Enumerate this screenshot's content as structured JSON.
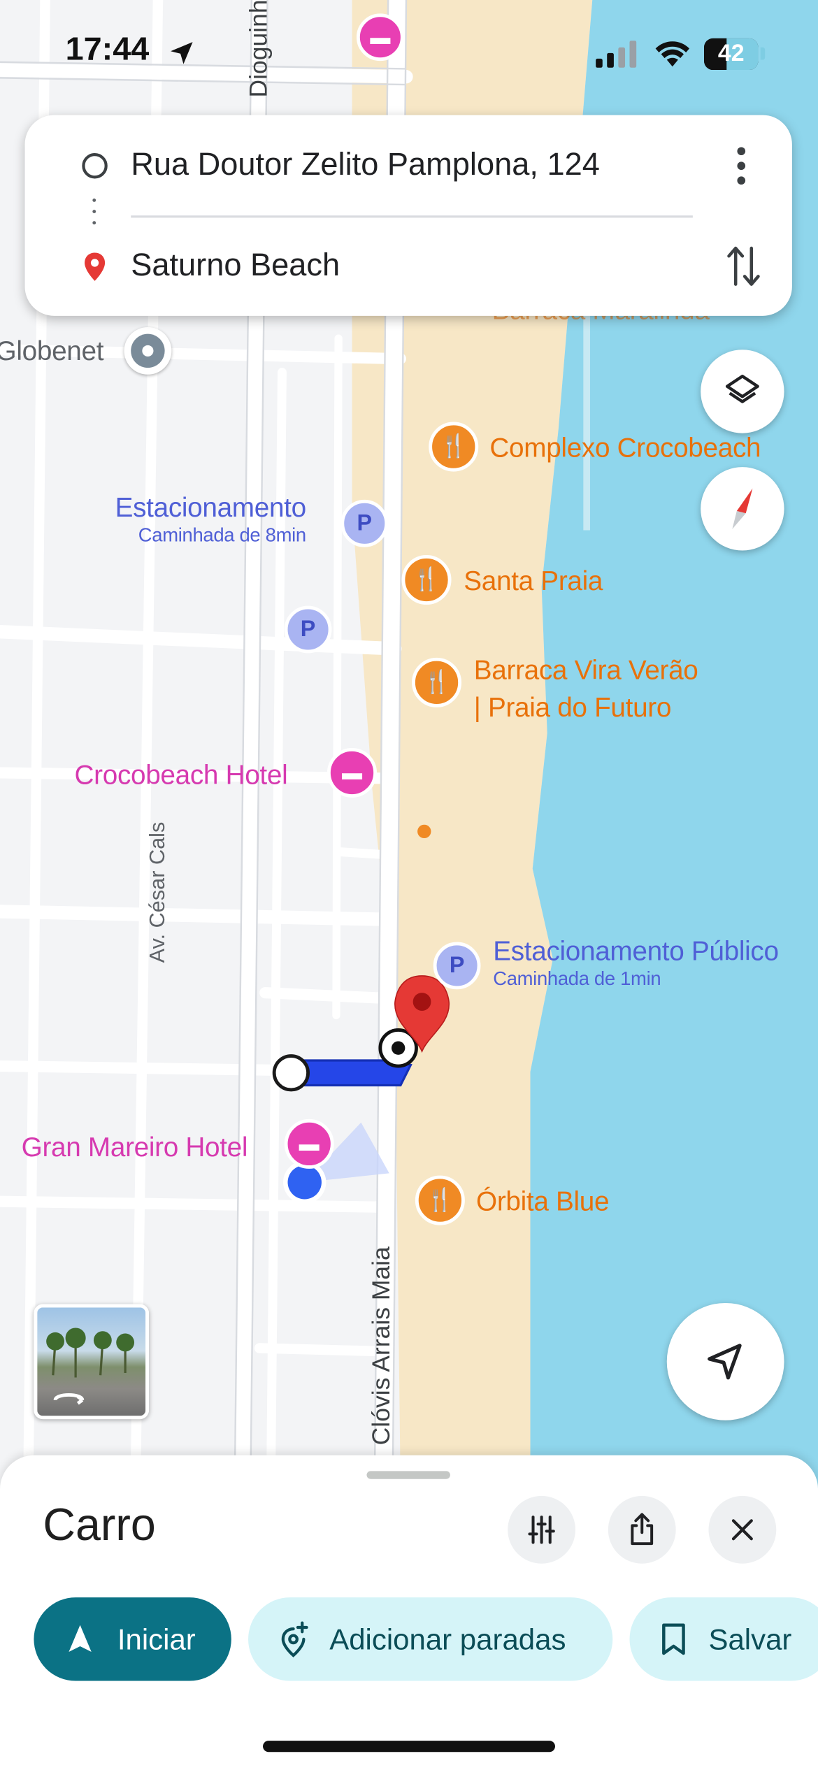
{
  "status_bar": {
    "time": "17:44",
    "battery": "42"
  },
  "route": {
    "origin": "Rua Doutor Zelito Pamplona, 124",
    "destination": "Saturno Beach"
  },
  "map": {
    "streets": {
      "top_street": "Dioguinh",
      "av_cesar_cals": "Av. César Cals",
      "clovis": "Clóvis Arrais Maia"
    },
    "places": {
      "globenet": "Globenet",
      "partial_top": "Barraca Maralinda",
      "complexo": "Complexo Crocobeach",
      "estacionamento": "Estacionamento",
      "estacionamento_sub": "Caminhada de 8min",
      "santa_praia": "Santa Praia",
      "vira_verao_1": "Barraca Vira Verão",
      "vira_verao_2": "| Praia do Futuro",
      "crocobeach_hotel": "Crocobeach Hotel",
      "estacionamento_publico": "Estacionamento Público",
      "estacionamento_publico_sub": "Caminhada de 1min",
      "gran_mareiro": "Gran Mareiro Hotel",
      "orbita_blue": "Órbita Blue"
    },
    "parking_glyph": "P"
  },
  "sheet": {
    "mode": "Carro",
    "start_label": "Iniciar",
    "add_stops_label": "Adicionar paradas",
    "save_label": "Salvar"
  },
  "icons": [
    "location-arrow-icon",
    "cell-signal-icon",
    "wifi-icon",
    "battery-icon",
    "origin-circle-icon",
    "destination-pin-icon",
    "more-vert-icon",
    "swap-icon",
    "layers-icon",
    "compass-icon",
    "restaurant-icon",
    "hotel-icon",
    "parking-icon",
    "my-location-icon",
    "street-view-thumbnail",
    "filter-icon",
    "share-icon",
    "close-icon",
    "navigation-icon",
    "add-location-icon",
    "bookmark-icon"
  ],
  "colors": {
    "sea": "#8fd6ec",
    "sand": "#f7e7c6",
    "route": "#2546e8",
    "accent": "#0b7285",
    "pill_light": "#d5f4f8",
    "orange_poi": "#e8710a",
    "pink_poi": "#d63ab0",
    "blue_poi": "#4f5fd6"
  }
}
